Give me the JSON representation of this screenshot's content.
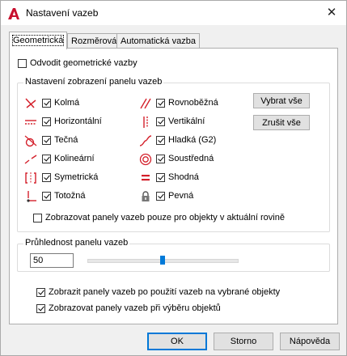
{
  "window": {
    "title": "Nastavení vazeb",
    "close_glyph": "✕"
  },
  "tabs": [
    {
      "label": "Geometrická"
    },
    {
      "label": "Rozměrová"
    },
    {
      "label": "Automatická vazba"
    }
  ],
  "infer": {
    "label": "Odvodit geometrické vazby",
    "checked": false
  },
  "display_group": {
    "title": "Nastavení zobrazení panelu vazeb",
    "left": [
      {
        "label": "Kolmá",
        "icon": "perpendicular-icon",
        "checked": true
      },
      {
        "label": "Horizontální",
        "icon": "horizontal-icon",
        "checked": true
      },
      {
        "label": "Tečná",
        "icon": "tangent-icon",
        "checked": true
      },
      {
        "label": "Kolineární",
        "icon": "collinear-icon",
        "checked": true
      },
      {
        "label": "Symetrická",
        "icon": "symmetric-icon",
        "checked": true
      },
      {
        "label": "Totožná",
        "icon": "coincident-icon",
        "checked": true
      }
    ],
    "right": [
      {
        "label": "Rovnoběžná",
        "icon": "parallel-icon",
        "checked": true
      },
      {
        "label": "Vertikální",
        "icon": "vertical-icon",
        "checked": true
      },
      {
        "label": "Hladká (G2)",
        "icon": "smooth-icon",
        "checked": true
      },
      {
        "label": "Soustředná",
        "icon": "concentric-icon",
        "checked": true
      },
      {
        "label": "Shodná",
        "icon": "equal-icon",
        "checked": true
      },
      {
        "label": "Pevná",
        "icon": "fix-lock-icon",
        "checked": true
      }
    ],
    "select_all": "Vybrat vše",
    "clear_all": "Zrušit vše",
    "plane_only": {
      "label": "Zobrazovat panely vazeb pouze pro objekty v aktuální rovině",
      "checked": false
    }
  },
  "transparency": {
    "title": "Průhlednost panelu vazeb",
    "value": "50",
    "level_percent": 50
  },
  "show_after_apply": {
    "label": "Zobrazit panely vazeb po použití vazeb na vybrané objekty",
    "checked": true
  },
  "show_on_select": {
    "label": "Zobrazovat panely vazeb při výběru objektů",
    "checked": true
  },
  "footer": {
    "ok": "OK",
    "cancel": "Storno",
    "help": "Nápověda"
  },
  "colors": {
    "accent": "#0078d7",
    "icon_red": "#d4202b",
    "slider_thumb": "#007ad9",
    "autocad_red": "#c8102e"
  }
}
